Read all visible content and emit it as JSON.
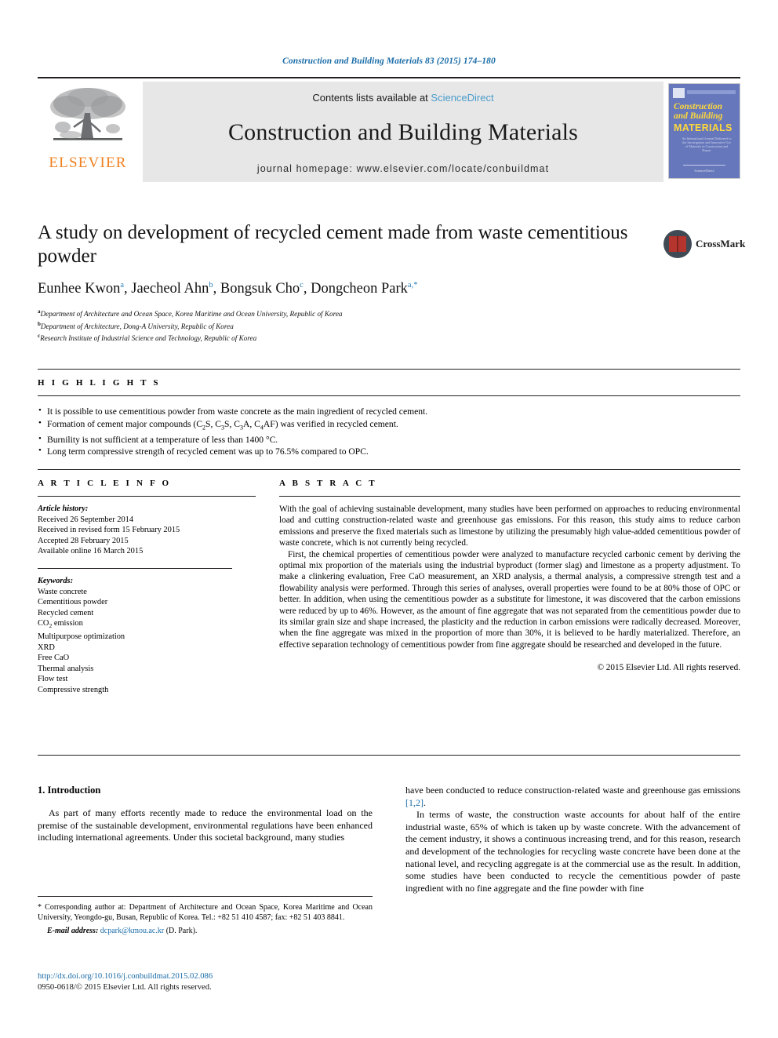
{
  "running_head": "Construction and Building Materials 83 (2015) 174–180",
  "masthead": {
    "contents_prefix": "Contents lists available at ",
    "sciencedirect": "ScienceDirect",
    "journal_name": "Construction and Building Materials",
    "homepage": "journal homepage: www.elsevier.com/locate/conbuildmat",
    "publisher_logo": "ELSEVIER",
    "cover": {
      "line1": "Construction",
      "line2": "and Building",
      "line3": "MATERIALS",
      "subtitle": "An International Journal Dedicated to the Investigation and Innovative Use of Materials in Construction and Repair",
      "footer": "ScienceDirect"
    }
  },
  "article": {
    "title": "A study on development of recycled cement made from waste cementitious powder",
    "authors": [
      {
        "name": "Eunhee Kwon",
        "marks": "a"
      },
      {
        "name": "Jaecheol Ahn",
        "marks": "b"
      },
      {
        "name": "Bongsuk Cho",
        "marks": "c"
      },
      {
        "name": "Dongcheon Park",
        "marks": "a,*"
      }
    ],
    "affiliations": [
      {
        "mark": "a",
        "text": "Department of Architecture and Ocean Space, Korea Maritime and Ocean University, Republic of Korea"
      },
      {
        "mark": "b",
        "text": "Department of Architecture, Dong-A University, Republic of Korea"
      },
      {
        "mark": "c",
        "text": "Research Institute of Industrial Science and Technology, Republic of Korea"
      }
    ],
    "crossmark_label": "CrossMark"
  },
  "highlights": {
    "heading": "H I G H L I G H T S",
    "items": [
      "It is possible to use cementitious powder from waste concrete as the main ingredient of recycled cement.",
      "Formation of cement major compounds (C2S, C3S, C3A, C4AF) was verified in recycled cement.",
      "Burnility is not sufficient at a temperature of less than 1400 °C.",
      "Long term compressive strength of recycled cement was up to 76.5% compared to OPC."
    ]
  },
  "article_info": {
    "heading": "A R T I C L E    I N F O",
    "history_label": "Article history:",
    "history": [
      "Received 26 September 2014",
      "Received in revised form 15 February 2015",
      "Accepted 28 February 2015",
      "Available online 16 March 2015"
    ],
    "keywords_label": "Keywords:",
    "keywords": [
      "Waste concrete",
      "Cementitious powder",
      "Recycled cement",
      "CO2 emission",
      "Multipurpose optimization",
      "XRD",
      "Free CaO",
      "Thermal analysis",
      "Flow test",
      "Compressive strength"
    ]
  },
  "abstract": {
    "heading": "A B S T R A C T",
    "paragraphs": [
      "With the goal of achieving sustainable development, many studies have been performed on approaches to reducing environmental load and cutting construction-related waste and greenhouse gas emissions. For this reason, this study aims to reduce carbon emissions and preserve the fixed materials such as limestone by utilizing the presumably high value-added cementitious powder of waste concrete, which is not currently being recycled.",
      "First, the chemical properties of cementitious powder were analyzed to manufacture recycled carbonic cement by deriving the optimal mix proportion of the materials using the industrial byproduct (former slag) and limestone as a property adjustment. To make a clinkering evaluation, Free CaO measurement, an XRD analysis, a thermal analysis, a compressive strength test and a flowability analysis were performed. Through this series of analyses, overall properties were found to be at 80% those of OPC or better. In addition, when using the cementitious powder as a substitute for limestone, it was discovered that the carbon emissions were reduced by up to 46%. However, as the amount of fine aggregate that was not separated from the cementitious powder due to its similar grain size and shape increased, the plasticity and the reduction in carbon emissions were radically decreased. Moreover, when the fine aggregate was mixed in the proportion of more than 30%, it is believed to be hardly materialized. Therefore, an effective separation technology of cementitious powder from fine aggregate should be researched and developed in the future."
    ],
    "copyright": "© 2015 Elsevier Ltd. All rights reserved."
  },
  "introduction": {
    "section_number_title": "1. Introduction",
    "left_paragraphs": [
      "As part of many efforts recently made to reduce the environmental load on the premise of the sustainable development, environmental regulations have been enhanced including international agreements. Under this societal background, many studies"
    ],
    "right_paragraphs": [
      "have been conducted to reduce construction-related waste and greenhouse gas emissions [1,2].",
      "In terms of waste, the construction waste accounts for about half of the entire industrial waste, 65% of which is taken up by waste concrete. With the advancement of the cement industry, it shows a continuous increasing trend, and for this reason, research and development of the technologies for recycling waste concrete have been done at the national level, and recycling aggregate is at the commercial use as the result. In addition, some studies have been conducted to recycle the cementitious powder of paste ingredient with no fine aggregate and the fine powder with fine"
    ],
    "right_reference": "[1,2]"
  },
  "footnote": {
    "corresponding": "* Corresponding author at: Department of Architecture and Ocean Space, Korea Maritime and Ocean University, Yeongdo-gu, Busan, Republic of Korea. Tel.: +82 51 410 4587; fax: +82 51 403 8841.",
    "email_label": "E-mail address:",
    "email": "dcpark@kmou.ac.kr",
    "email_suffix": "(D. Park)."
  },
  "footer": {
    "doi": "http://dx.doi.org/10.1016/j.conbuildmat.2015.02.086",
    "issn": "0950-0618/© 2015 Elsevier Ltd. All rights reserved."
  },
  "colors": {
    "link_blue": "#1a6ca8",
    "sciencedirect_blue": "#4a9ccc",
    "elsevier_orange": "#f08020",
    "cover_blue": "#6677bb",
    "cover_yellow": "#ffd83b"
  }
}
